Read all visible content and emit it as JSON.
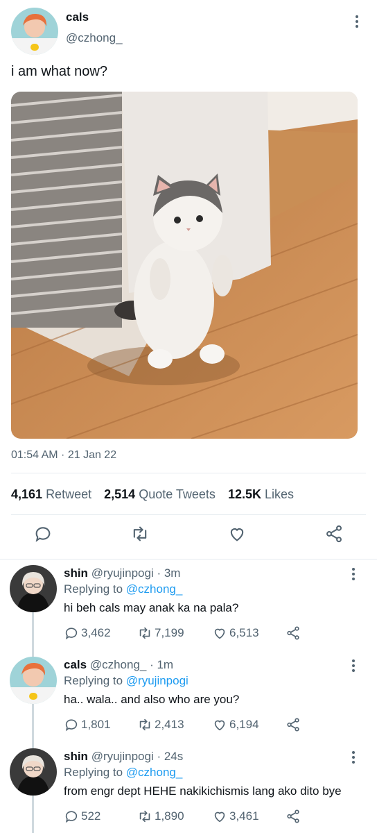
{
  "tweet": {
    "author_name": "cals",
    "author_handle": "@czhong_",
    "text": "i am what now?",
    "timestamp": "01:54 AM · 21 Jan 22",
    "stats": {
      "retweets": "4,161",
      "retweets_label": "Retweet",
      "quotes": "2,514",
      "quotes_label": "Quote Tweets",
      "likes": "12.5K",
      "likes_label": "Likes"
    }
  },
  "replies": [
    {
      "name": "shin",
      "handle": "@ryujinpogi",
      "time": "· 3m",
      "replying_prefix": "Replying to",
      "replying_to": "@czhong_",
      "text": "hi beh cals may anak ka na pala?",
      "replies": "3,462",
      "retweets": "7,199",
      "likes": "6,513"
    },
    {
      "name": "cals",
      "handle": "@czhong_",
      "time": "· 1m",
      "replying_prefix": "Replying to",
      "replying_to": "@ryujinpogi",
      "text": "ha.. wala.. and also who are you?",
      "replies": "1,801",
      "retweets": "2,413",
      "likes": "6,194"
    },
    {
      "name": "shin",
      "handle": "@ryujinpogi",
      "time": "· 24s",
      "replying_prefix": "Replying to",
      "replying_to": "@czhong_",
      "text": "from engr dept HEHE nakikichismis lang ako dito bye",
      "replies": "522",
      "retweets": "1,890",
      "likes": "3,461"
    }
  ],
  "colors": {
    "accent": "#1d9bf0",
    "muted": "#536471",
    "text": "#0f1419",
    "divider": "#e6ecf0"
  },
  "icons": [
    "more-vertical-icon",
    "reply-icon",
    "retweet-icon",
    "like-icon",
    "share-icon"
  ]
}
